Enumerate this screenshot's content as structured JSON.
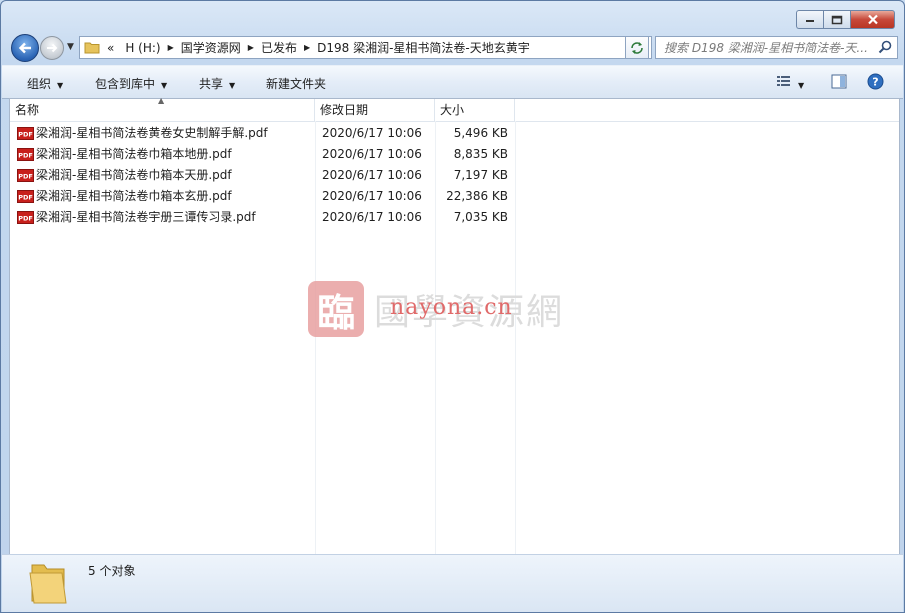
{
  "window": {
    "minimize_icon": "minimize-icon",
    "maximize_icon": "maximize-icon",
    "close_icon": "close-icon"
  },
  "address": {
    "overflow": "«",
    "crumbs": [
      {
        "label": "H (H:)"
      },
      {
        "label": "国学资源网"
      },
      {
        "label": "已发布"
      },
      {
        "label": "D198 梁湘润-星相书简法卷-天地玄黄宇"
      }
    ]
  },
  "search": {
    "placeholder": "搜索 D198 梁湘润-星相书简法卷-天..."
  },
  "toolbar": {
    "organize": "组织",
    "include_library": "包含到库中",
    "share": "共享",
    "new_folder": "新建文件夹"
  },
  "columns": {
    "name": "名称",
    "date": "修改日期",
    "size": "大小"
  },
  "files": [
    {
      "name": "梁湘润-星相书简法卷黄卷女史制解手解.pdf",
      "date": "2020/6/17 10:06",
      "size": "5,496 KB"
    },
    {
      "name": "梁湘润-星相书简法卷巾箱本地册.pdf",
      "date": "2020/6/17 10:06",
      "size": "8,835 KB"
    },
    {
      "name": "梁湘润-星相书简法卷巾箱本天册.pdf",
      "date": "2020/6/17 10:06",
      "size": "7,197 KB"
    },
    {
      "name": "梁湘润-星相书简法卷巾箱本玄册.pdf",
      "date": "2020/6/17 10:06",
      "size": "22,386 KB"
    },
    {
      "name": "梁湘润-星相书简法卷宇册三谭传习录.pdf",
      "date": "2020/6/17 10:06",
      "size": "7,035 KB"
    }
  ],
  "watermark": {
    "seal": "臨",
    "text": "國學資源網",
    "url": "nayona.cn"
  },
  "status": {
    "count": "5 个对象"
  },
  "colors": {
    "accent": "#2a64b5",
    "pdf_red": "#c8201c",
    "watermark_red": "#e06a6a"
  }
}
